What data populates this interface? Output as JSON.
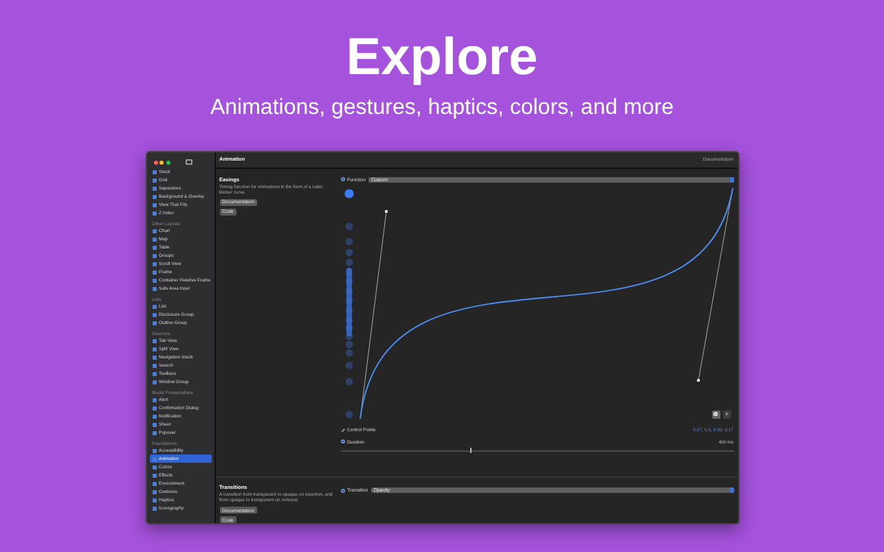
{
  "hero": {
    "title": "Explore",
    "subtitle": "Animations, gestures, haptics, colors, and more"
  },
  "window": {
    "title": "Animation",
    "toolbar_link": "Documentation"
  },
  "sidebar": {
    "sections": [
      {
        "items": [
          {
            "label": "Stack",
            "selected": false
          },
          {
            "label": "Grid",
            "selected": false
          },
          {
            "label": "Separators",
            "selected": false
          },
          {
            "label": "Background & Overlay",
            "selected": false
          },
          {
            "label": "View That Fits",
            "selected": false
          },
          {
            "label": "Z Index",
            "selected": false
          }
        ]
      },
      {
        "heading": "Other Layouts",
        "items": [
          {
            "label": "Chart",
            "selected": false
          },
          {
            "label": "Map",
            "selected": false
          },
          {
            "label": "Table",
            "selected": false
          },
          {
            "label": "Groups",
            "selected": false
          },
          {
            "label": "Scroll View",
            "selected": false
          },
          {
            "label": "Frame",
            "selected": false
          },
          {
            "label": "Container Relative Frame",
            "selected": false
          },
          {
            "label": "Safe Area Inset",
            "selected": false
          }
        ]
      },
      {
        "heading": "Lists",
        "items": [
          {
            "label": "List",
            "selected": false
          },
          {
            "label": "Disclosure Group",
            "selected": false
          },
          {
            "label": "Outline Group",
            "selected": false
          }
        ]
      },
      {
        "heading": "Structure",
        "items": [
          {
            "label": "Tab View",
            "selected": false
          },
          {
            "label": "Split View",
            "selected": false
          },
          {
            "label": "Navigation Stack",
            "selected": false
          },
          {
            "label": "Search",
            "selected": false
          },
          {
            "label": "Toolbars",
            "selected": false
          },
          {
            "label": "Window Group",
            "selected": false
          }
        ]
      },
      {
        "heading": "Modal Presentations",
        "items": [
          {
            "label": "Alert",
            "selected": false
          },
          {
            "label": "Confirmation Dialog",
            "selected": false
          },
          {
            "label": "Notification",
            "selected": false
          },
          {
            "label": "Sheet",
            "selected": false
          },
          {
            "label": "Popover",
            "selected": false
          }
        ]
      },
      {
        "heading": "Foundations",
        "items": [
          {
            "label": "Accessibility",
            "selected": false
          },
          {
            "label": "Animation",
            "selected": true
          },
          {
            "label": "Colors",
            "selected": false
          },
          {
            "label": "Effects",
            "selected": false
          },
          {
            "label": "Environment",
            "selected": false
          },
          {
            "label": "Gestures",
            "selected": false
          },
          {
            "label": "Haptics",
            "selected": false
          },
          {
            "label": "Iconography",
            "selected": false
          }
        ]
      }
    ]
  },
  "easings": {
    "title": "Easings",
    "description": "Timing function for animations in the form of a cubic Bézier curve.",
    "buttons": [
      "Documentation",
      "Code"
    ],
    "function": {
      "label": "Function",
      "value": "Custom"
    },
    "control_points": {
      "label": "Control Points",
      "value": "0.07, 0.9, 0.93, 0.17"
    },
    "duration": {
      "label": "Duration",
      "value": "400 ms",
      "level": 0.33
    }
  },
  "transitions": {
    "title": "Transitions",
    "description": "A transition from transparent to opaque on insertion, and from opaque to transparent on removal.",
    "buttons": [
      "Documentation",
      "Code"
    ],
    "picker": {
      "label": "Transition",
      "value": "Opacity"
    }
  }
}
